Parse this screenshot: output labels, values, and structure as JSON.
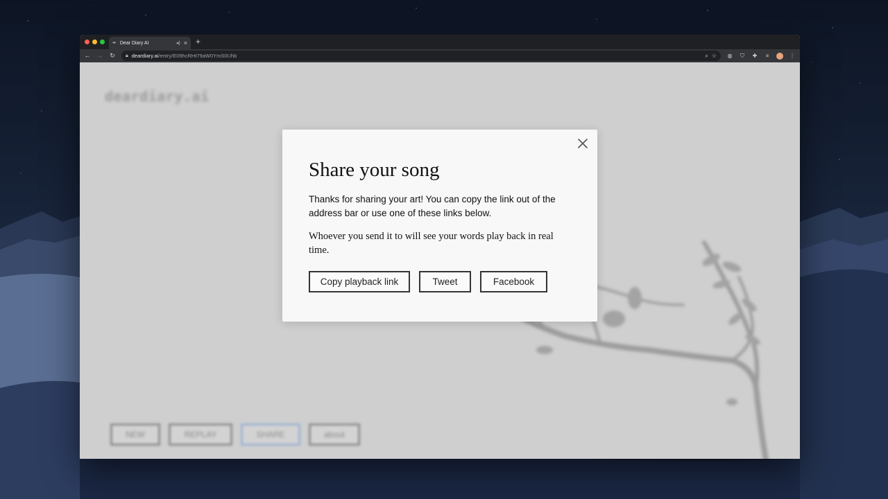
{
  "browser": {
    "tab_title": "Dear Diary AI",
    "tab_favicon": "quill-icon",
    "url_host": "deardiary.ai",
    "url_path": "/entry/E09hcRHt79aW0YmS0Uhb"
  },
  "site": {
    "logo": "deardiary.ai",
    "buttons": [
      "NEW",
      "REPLAY",
      "SHARE",
      "about"
    ]
  },
  "modal": {
    "title": "Share your song",
    "paragraph1": "Thanks for sharing your art! You can copy the link out of the address bar or use one of these links below.",
    "paragraph2": "Whoever you send it to will see your words play back in real time.",
    "buttons": {
      "copy": "Copy playback link",
      "tweet": "Tweet",
      "facebook": "Facebook"
    }
  }
}
